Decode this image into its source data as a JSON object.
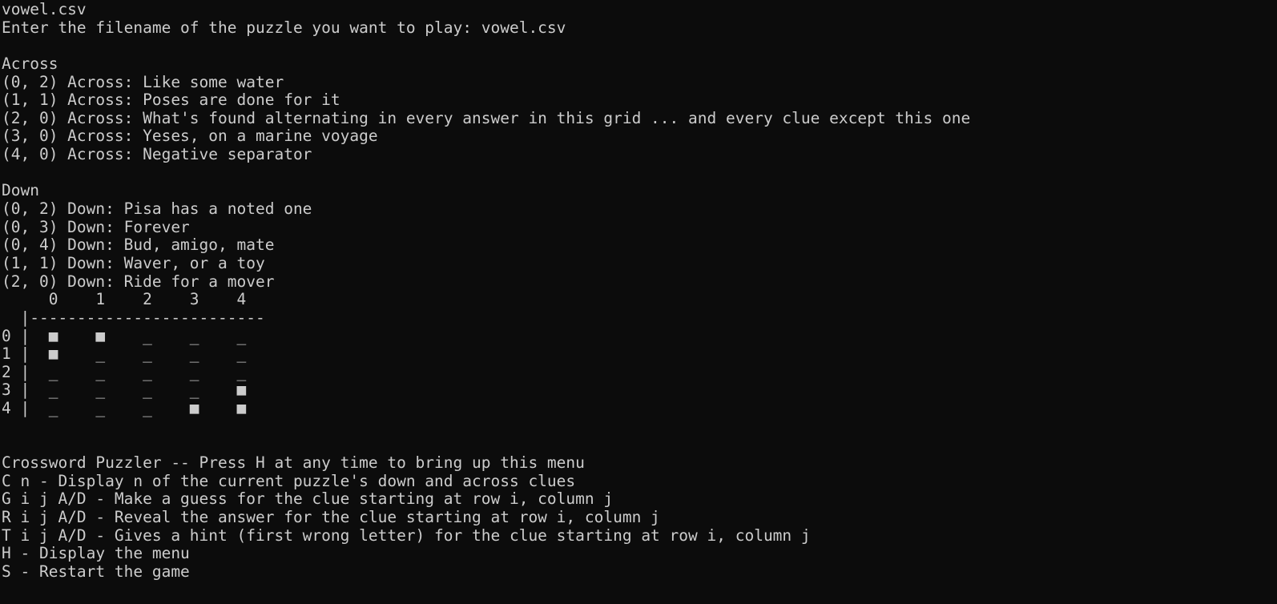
{
  "session": {
    "typed_filename": "vowel.csv",
    "prompt": "Enter the filename of the puzzle you want to play: vowel.csv"
  },
  "across": {
    "header": "Across",
    "clues": [
      "(0, 2) Across: Like some water",
      "(1, 1) Across: Poses are done for it",
      "(2, 0) Across: What's found alternating in every answer in this grid ... and every clue except this one",
      "(3, 0) Across: Yeses, on a marine voyage",
      "(4, 0) Across: Negative separator"
    ]
  },
  "down": {
    "header": "Down",
    "clues": [
      "(0, 2) Down: Pisa has a noted one",
      "(0, 3) Down: Forever",
      "(0, 4) Down: Bud, amigo, mate",
      "(1, 1) Down: Waver, or a toy",
      "(2, 0) Down: Ride for a mover"
    ]
  },
  "grid": {
    "column_header": "     0    1    2    3    4",
    "divider": "  |-------------------------",
    "rows": [
      "0 |  ■    ■    _    _    _",
      "1 |  ■    _    _    _    _",
      "2 |  _    _    _    _    _",
      "3 |  _    _    _    _    ■",
      "4 |  _    _    _    ■    ■"
    ]
  },
  "menu": {
    "title": "Crossword Puzzler -- Press H at any time to bring up this menu",
    "items": [
      "C n - Display n of the current puzzle's down and across clues",
      "G i j A/D - Make a guess for the clue starting at row i, column j",
      "R i j A/D - Reveal the answer for the clue starting at row i, column j",
      "T i j A/D - Gives a hint (first wrong letter) for the clue starting at row i, column j",
      "H - Display the menu",
      "S - Restart the game"
    ]
  },
  "colors": {
    "background": "#0c0c0c",
    "foreground": "#cccccc"
  }
}
